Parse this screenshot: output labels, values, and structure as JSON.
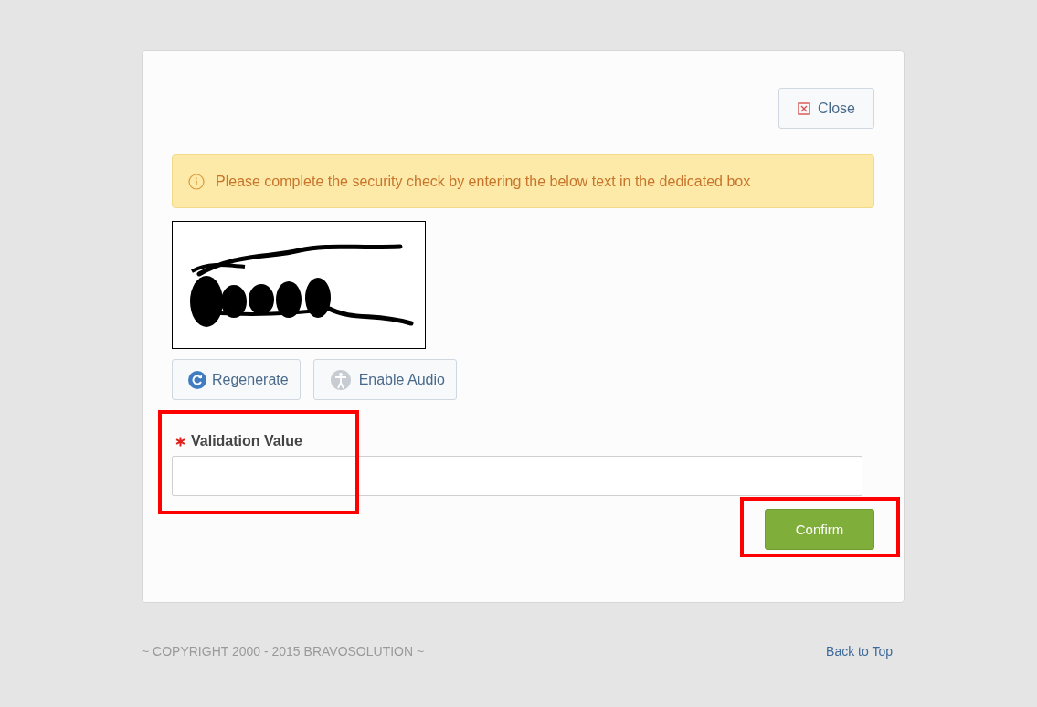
{
  "close_button": {
    "label": "Close"
  },
  "alert": {
    "message": "Please complete the security check by entering the below text in the dedicated box"
  },
  "captcha_buttons": [
    {
      "label": "Regenerate",
      "kind": "regenerate"
    },
    {
      "label": "Enable Audio",
      "kind": "audio"
    }
  ],
  "field": {
    "label": "Validation Value",
    "required": true
  },
  "confirm_button": {
    "label": "Confirm"
  },
  "footer": {
    "copyright": "~ COPYRIGHT 2000 - 2015 BRAVOSOLUTION ~",
    "back_to_top": "Back to Top"
  }
}
